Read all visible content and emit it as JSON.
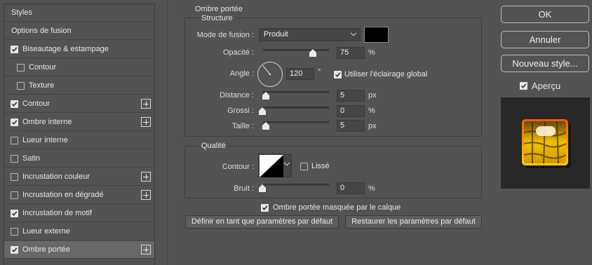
{
  "effects_list": {
    "items": [
      {
        "label": "Styles",
        "checkbox": false,
        "checked": false,
        "plus": false,
        "indent": false,
        "active": false
      },
      {
        "label": "Options de fusion",
        "checkbox": false,
        "checked": false,
        "plus": false,
        "indent": false,
        "active": false
      },
      {
        "label": "Biseautage & estampage",
        "checkbox": true,
        "checked": true,
        "plus": false,
        "indent": false,
        "active": false
      },
      {
        "label": "Contour",
        "checkbox": true,
        "checked": false,
        "plus": false,
        "indent": true,
        "active": false
      },
      {
        "label": "Texture",
        "checkbox": true,
        "checked": false,
        "plus": false,
        "indent": true,
        "active": false
      },
      {
        "label": "Contour",
        "checkbox": true,
        "checked": true,
        "plus": true,
        "indent": false,
        "active": false
      },
      {
        "label": "Ombre interne",
        "checkbox": true,
        "checked": true,
        "plus": true,
        "indent": false,
        "active": false
      },
      {
        "label": "Lueur interne",
        "checkbox": true,
        "checked": false,
        "plus": false,
        "indent": false,
        "active": false
      },
      {
        "label": "Satin",
        "checkbox": true,
        "checked": false,
        "plus": false,
        "indent": false,
        "active": false
      },
      {
        "label": "Incrustation couleur",
        "checkbox": true,
        "checked": false,
        "plus": true,
        "indent": false,
        "active": false
      },
      {
        "label": "Incrustation en dégradé",
        "checkbox": true,
        "checked": false,
        "plus": true,
        "indent": false,
        "active": false
      },
      {
        "label": "Incrustation de motif",
        "checkbox": true,
        "checked": true,
        "plus": false,
        "indent": false,
        "active": false
      },
      {
        "label": "Lueur externe",
        "checkbox": true,
        "checked": false,
        "plus": false,
        "indent": false,
        "active": false
      },
      {
        "label": "Ombre portée",
        "checkbox": true,
        "checked": true,
        "plus": true,
        "indent": false,
        "active": true
      }
    ]
  },
  "panel": {
    "title": "Ombre portée",
    "structure": {
      "legend": "Structure",
      "blend_mode_label": "Mode de fusion :",
      "blend_mode_value": "Produit",
      "shadow_color": "#000000",
      "opacity_label": "Opacité :",
      "opacity_value": "75",
      "opacity_level": 0.75,
      "opacity_unit": "%",
      "angle_label": "Angle :",
      "angle_value": "120",
      "angle_unit": "°",
      "global_light_label": "Utiliser l'éclairage global",
      "global_light_checked": true,
      "distance_label": "Distance :",
      "distance_value": "5",
      "distance_unit": "px",
      "spread_label": "Grossi :",
      "spread_value": "0",
      "spread_unit": "%",
      "size_label": "Taille :",
      "size_value": "5",
      "size_unit": "px"
    },
    "quality": {
      "legend": "Qualité",
      "contour_label": "Contour :",
      "antialias_label": "Lissé",
      "antialias_checked": false,
      "noise_label": "Bruit :",
      "noise_value": "0",
      "noise_unit": "%"
    },
    "knockout_label": "Ombre portée masquée par le calque",
    "knockout_checked": true,
    "set_default_label": "Définir en tant que paramètres par défaut",
    "reset_default_label": "Restaurer les paramètres par défaut"
  },
  "right": {
    "ok_label": "OK",
    "cancel_label": "Annuler",
    "new_style_label": "Nouveau style...",
    "preview_label": "Aperçu",
    "preview_checked": true
  },
  "colors": {
    "background": "#535353",
    "active_row": "#686868",
    "preview_bg": "#282828",
    "preview_gold": "#e0b000"
  }
}
